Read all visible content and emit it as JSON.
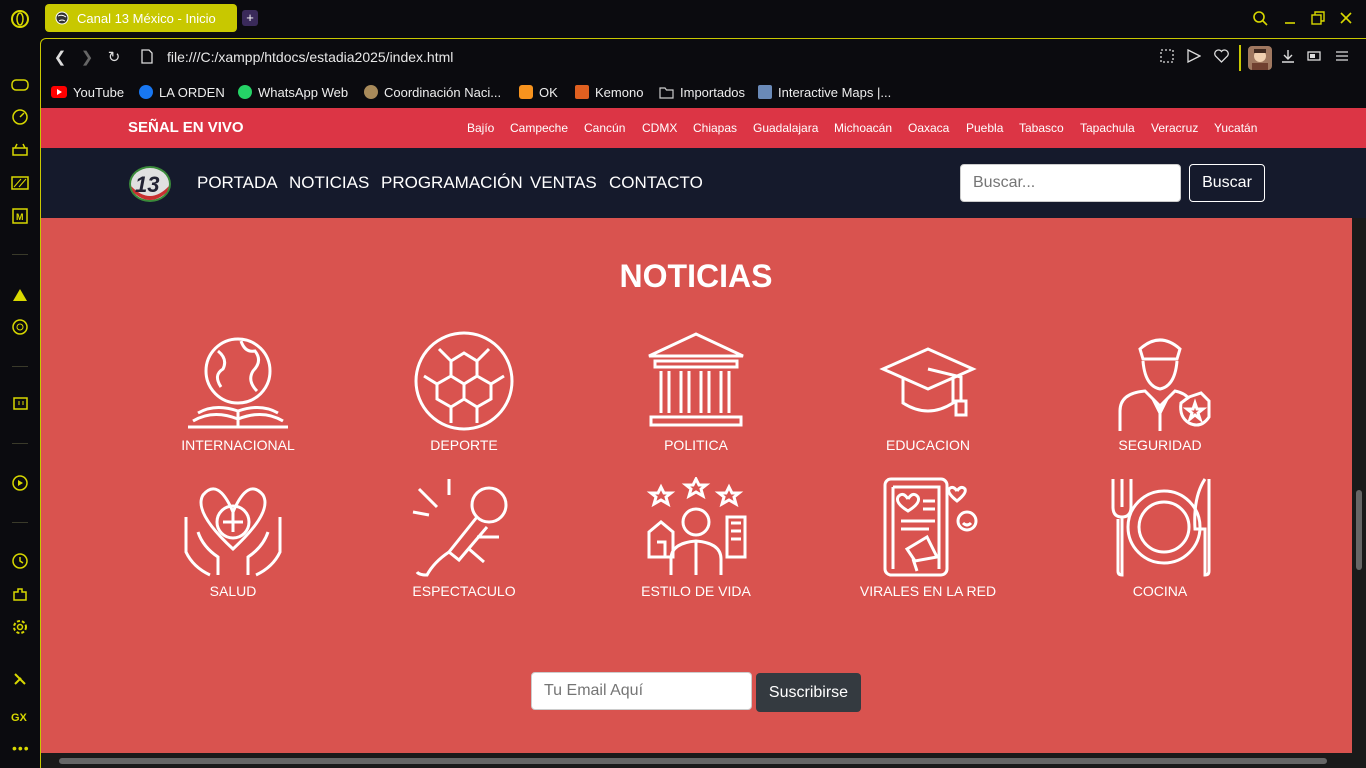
{
  "browser": {
    "tab_title": "Canal 13 México - Inicio",
    "new_tab": "+",
    "url": "file:///C:/xampp/htdocs/estadia2025/index.html",
    "accent": "#c8c800",
    "bookmarks": [
      {
        "label": "YouTube",
        "icon": "youtube-icon",
        "color": "#ff0000"
      },
      {
        "label": "LA ORDEN",
        "icon": "facebook-icon",
        "color": "#1877f2"
      },
      {
        "label": "WhatsApp Web",
        "icon": "whatsapp-icon",
        "color": "#25d366"
      },
      {
        "label": "Coordinación Naci...",
        "icon": "seal-icon",
        "color": "#a88a5a"
      },
      {
        "label": "OK",
        "icon": "ok-icon",
        "color": "#f7931e"
      },
      {
        "label": "Kemono",
        "icon": "fox-icon",
        "color": "#e06020"
      },
      {
        "label": "Importados",
        "icon": "folder-icon",
        "color": "#cccccc"
      },
      {
        "label": "Interactive Maps |...",
        "icon": "map-icon",
        "color": "#6a8ab8"
      }
    ]
  },
  "page": {
    "live_label": "SEÑAL EN VIVO",
    "cities": [
      "Bajío",
      "Campeche",
      "Cancún",
      "CDMX",
      "Chiapas",
      "Guadalajara",
      "Michoacán",
      "Oaxaca",
      "Puebla",
      "Tabasco",
      "Tapachula",
      "Veracruz",
      "Yucatán"
    ],
    "logo_text": "13",
    "menu": [
      "PORTADA",
      "NOTICIAS",
      "PROGRAMACIÓN",
      "VENTAS",
      "CONTACTO"
    ],
    "search_placeholder": "Buscar...",
    "search_button": "Buscar",
    "section_title": "NOTICIAS",
    "categories": [
      {
        "label": "INTERNACIONAL",
        "icon": "globe-book-icon"
      },
      {
        "label": "DEPORTE",
        "icon": "soccer-ball-icon"
      },
      {
        "label": "POLITICA",
        "icon": "government-building-icon"
      },
      {
        "label": "EDUCACION",
        "icon": "graduation-cap-icon"
      },
      {
        "label": "SEGURIDAD",
        "icon": "police-officer-icon"
      },
      {
        "label": "SALUD",
        "icon": "heart-hands-icon"
      },
      {
        "label": "ESPECTACULO",
        "icon": "microphone-icon"
      },
      {
        "label": "ESTILO DE VIDA",
        "icon": "lifestyle-person-icon"
      },
      {
        "label": "VIRALES EN LA RED",
        "icon": "phone-megaphone-icon"
      },
      {
        "label": "COCINA",
        "icon": "plate-cutlery-icon"
      }
    ],
    "email_placeholder": "Tu Email Aquí",
    "subscribe_button": "Suscribirse",
    "colors": {
      "topbar": "#dc3545",
      "navbar": "#151a2c",
      "body": "#d9534f"
    }
  }
}
